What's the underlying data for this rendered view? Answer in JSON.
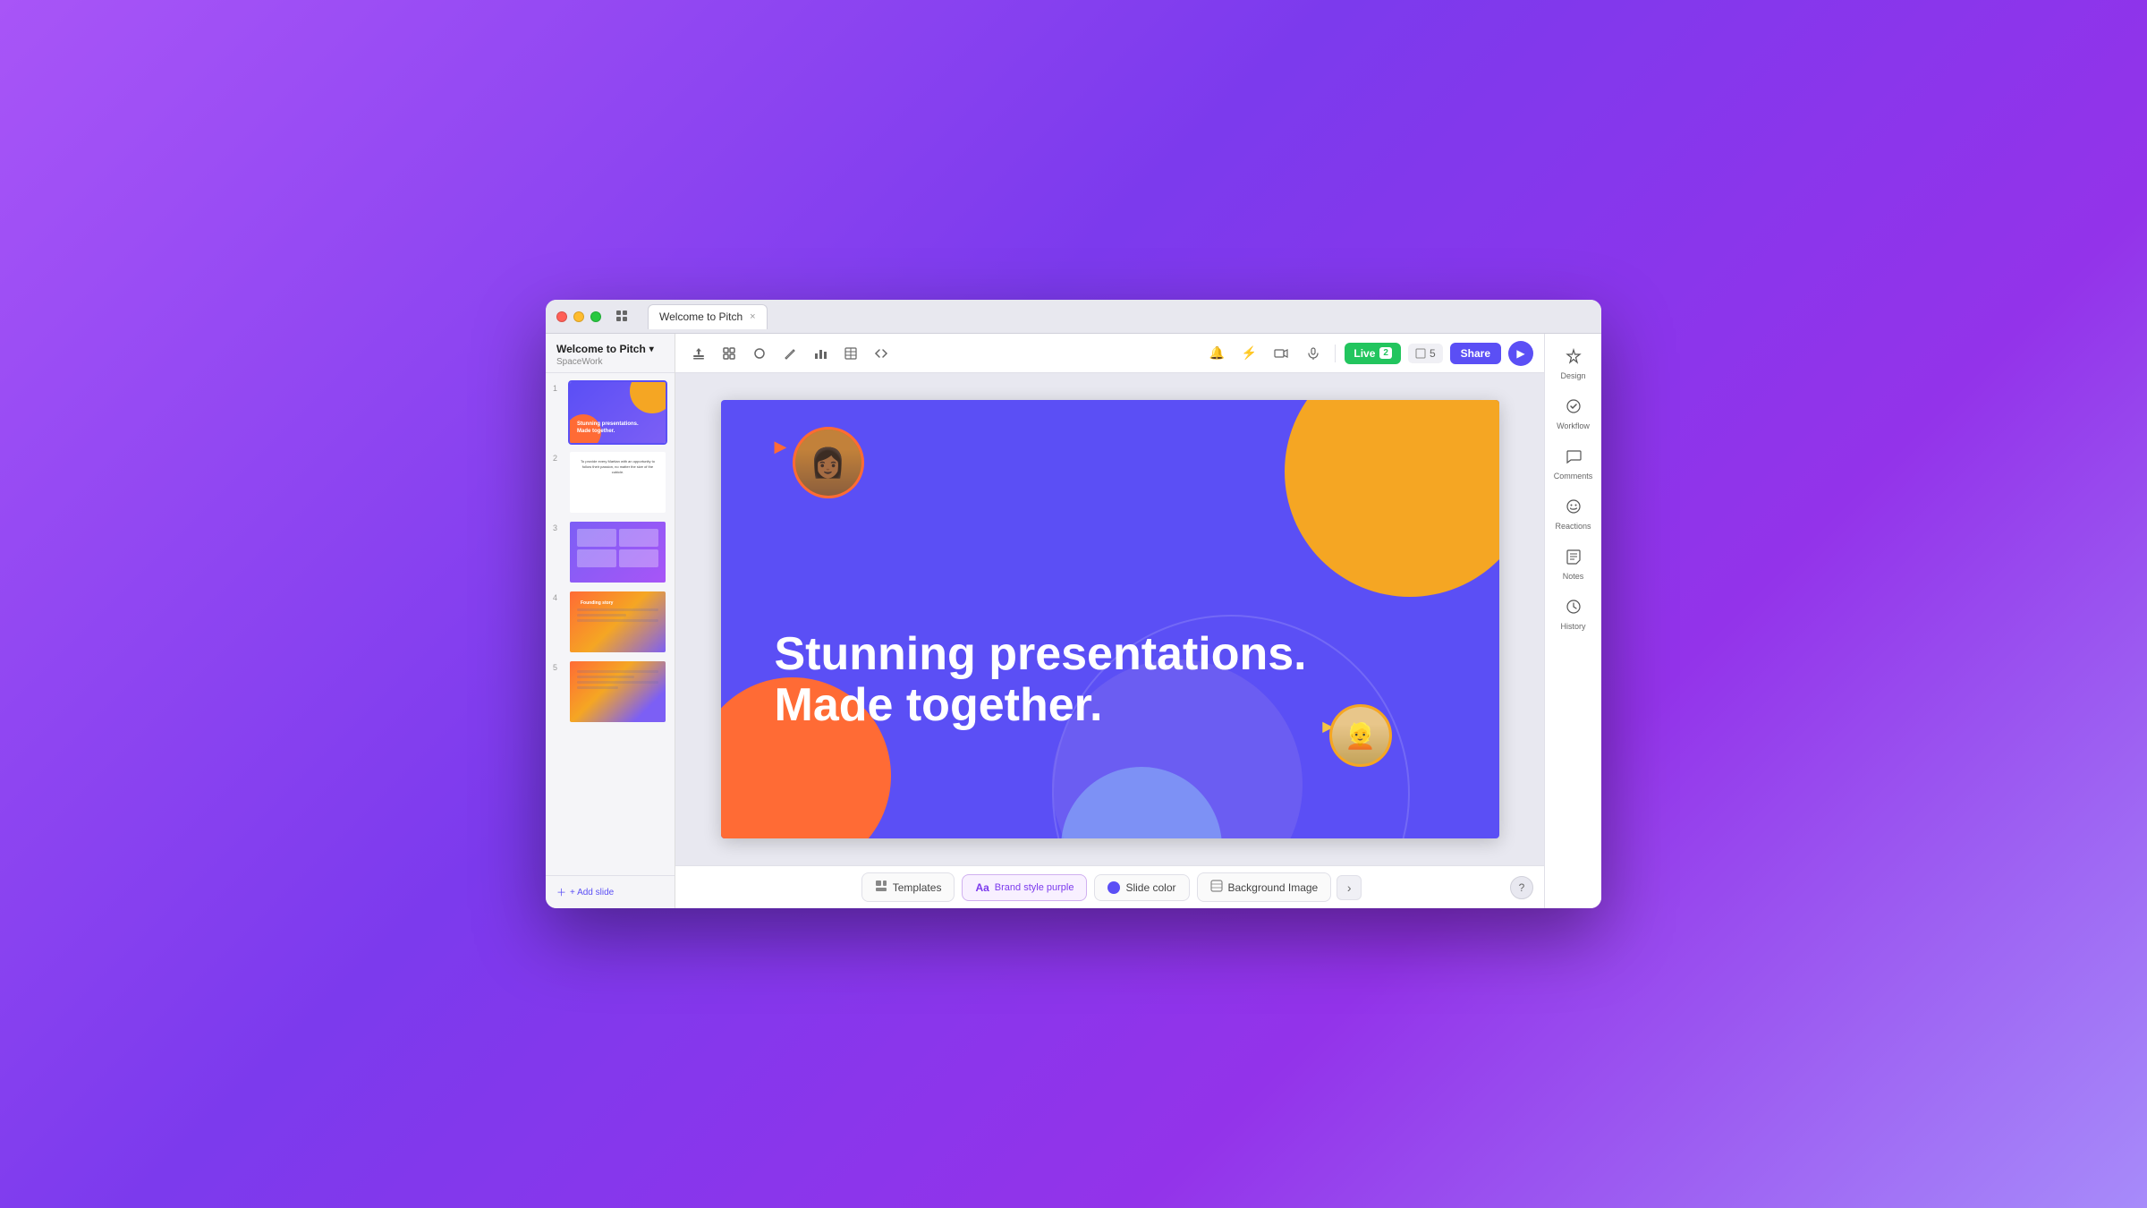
{
  "window": {
    "title": "Welcome to Pitch",
    "subtitle": "SpaceWork"
  },
  "tabs": [
    {
      "label": "Welcome to Pitch",
      "active": true
    }
  ],
  "toolbar": {
    "live_label": "Live",
    "live_count": "2",
    "slide_count": "5",
    "share_label": "Share"
  },
  "sidebar": {
    "title": "Welcome to Pitch",
    "workspace": "SpaceWork",
    "add_slide": "+ Add slide",
    "slides": [
      {
        "number": "1",
        "active": true
      },
      {
        "number": "2",
        "active": false
      },
      {
        "number": "3",
        "active": false
      },
      {
        "number": "4",
        "active": false
      },
      {
        "number": "5",
        "active": false
      }
    ]
  },
  "slide": {
    "text_line1": "Stunning presentations.",
    "text_line2": "Made together."
  },
  "right_panel": {
    "items": [
      {
        "label": "Design",
        "icon": "✦"
      },
      {
        "label": "Workflow",
        "icon": "✓"
      },
      {
        "label": "Comments",
        "icon": "💬"
      },
      {
        "label": "Reactions",
        "icon": "🙂"
      },
      {
        "label": "Notes",
        "icon": "📝"
      },
      {
        "label": "History",
        "icon": "🕐"
      }
    ]
  },
  "bottom_toolbar": {
    "templates_label": "Templates",
    "brand_style_label": "Brand style purple",
    "slide_color_label": "Slide color",
    "background_image_label": "Background Image",
    "help_label": "?"
  },
  "icons": {
    "close": "×",
    "chevron_down": "▾",
    "play": "▶",
    "bell": "🔔",
    "bolt": "⚡",
    "video": "□",
    "mic": "🎙",
    "upload": "⬆",
    "layout": "⊞",
    "shapes": "◯",
    "chart": "▦",
    "table": "⊟",
    "code": "⌥"
  }
}
